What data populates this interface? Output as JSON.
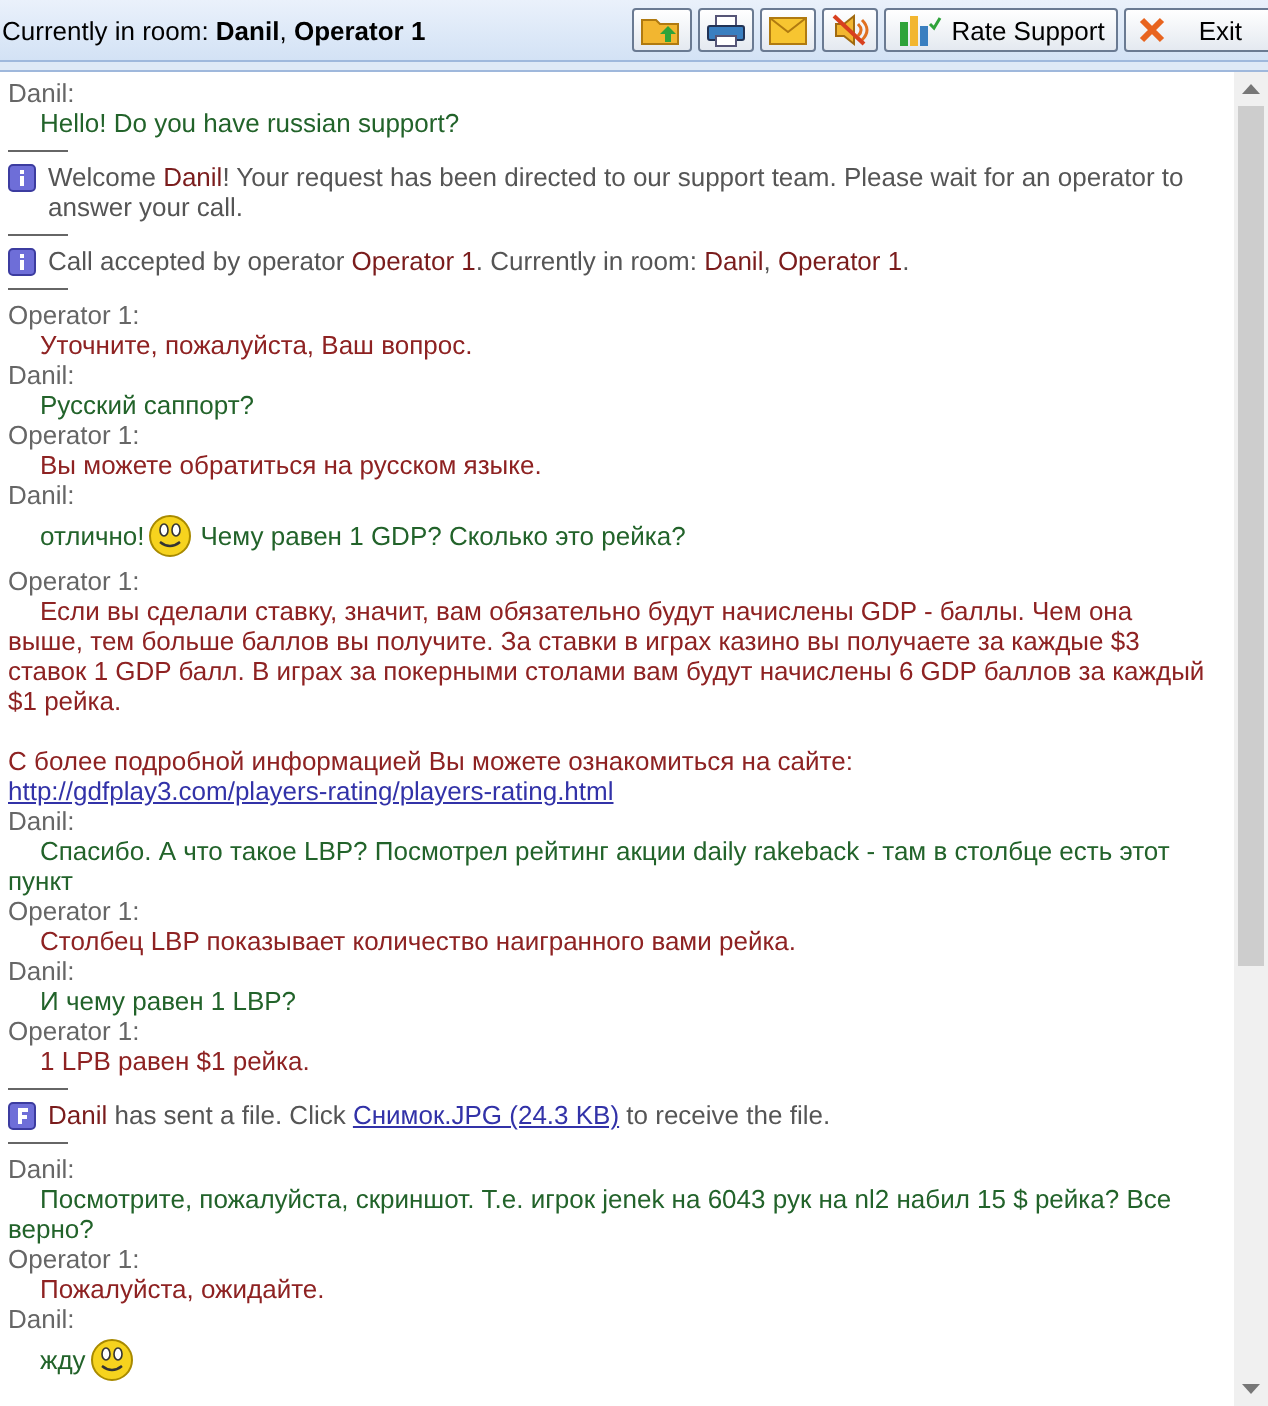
{
  "header": {
    "room": "Currently in room: **Danil**, **Operator 1**"
  },
  "toolbar": [
    {
      "kind": "send-file"
    },
    {
      "kind": "print"
    },
    {
      "kind": "email"
    },
    {
      "kind": "sound"
    },
    {
      "kind": "rate",
      "label": "Rate Support"
    },
    {
      "kind": "exit",
      "label": "Exit"
    }
  ],
  "transcript": [
    {
      "kind": "visitor",
      "sender": "Danil:",
      "body": [
        {
          "kind": "text",
          "text": "Hello! Do you have russian support?"
        }
      ]
    },
    {
      "kind": "info",
      "segments": [
        {
          "kind": "plain",
          "text": "Welcome "
        },
        {
          "kind": "name",
          "text": "Danil"
        },
        {
          "kind": "plain",
          "text": "! Your request has been directed to our support team. Please wait for an operator to answer your call."
        }
      ]
    },
    {
      "kind": "info",
      "segments": [
        {
          "kind": "plain",
          "text": "Call accepted by operator "
        },
        {
          "kind": "name",
          "text": "Operator 1"
        },
        {
          "kind": "plain",
          "text": ". Currently in room: "
        },
        {
          "kind": "name",
          "text": "Danil",
          "after": ", "
        },
        {
          "kind": "name",
          "text": "Operator 1",
          "after": "."
        }
      ]
    },
    {
      "kind": "operator",
      "sender": "Operator 1:",
      "body": [
        {
          "kind": "text",
          "text": "Уточните, пожалуйста, Ваш вопрос."
        }
      ]
    },
    {
      "kind": "visitor",
      "sender": "Danil:",
      "body": [
        {
          "kind": "text",
          "text": "Русский саппорт?"
        }
      ]
    },
    {
      "kind": "operator",
      "sender": "Operator 1:",
      "body": [
        {
          "kind": "text",
          "text": "Вы можете обратиться на русском языке."
        }
      ]
    },
    {
      "kind": "visitor",
      "sender": "Danil:",
      "body": [
        {
          "kind": "text",
          "text": "отлично!"
        },
        {
          "kind": "smiley"
        },
        {
          "kind": "text",
          "text": "Чему равен 1 GDP? Сколько это рейка?"
        }
      ]
    },
    {
      "kind": "operator",
      "sender": "Operator 1:",
      "body": [
        {
          "kind": "text",
          "text": "Если вы сделали ставку, значит, вам обязательно будут начислены GDP - баллы. Чем она выше, тем больше баллов вы получите. За ставки в играх казино вы получаете за каждые $3 ставок 1 GDP балл. В играх за покерными столами вам будут начислены 6 GDP баллов за каждый $1 рейка."
        },
        {
          "kind": "gap"
        },
        {
          "kind": "text",
          "text": "С более подробной информацией Вы можете ознакомиться на сайте:"
        },
        {
          "kind": "break"
        },
        {
          "kind": "link",
          "text": "http://gdfplay3.com/players-rating/players-rating.html"
        }
      ]
    },
    {
      "kind": "visitor",
      "sender": "Danil:",
      "body": [
        {
          "kind": "text",
          "text": "Спасибо. А что такое LBP? Посмотрел рейтинг акции daily rakeback - там в столбце есть этот пункт"
        }
      ]
    },
    {
      "kind": "operator",
      "sender": "Operator 1:",
      "body": [
        {
          "kind": "text",
          "text": "Столбец LBP показывает количество наигранного вами рейка."
        }
      ]
    },
    {
      "kind": "visitor",
      "sender": "Danil:",
      "body": [
        {
          "kind": "text",
          "text": "И чему равен 1 LBP?"
        }
      ]
    },
    {
      "kind": "operator",
      "sender": "Operator 1:",
      "body": [
        {
          "kind": "text",
          "text": "1 LPB равен $1 рейка."
        }
      ]
    },
    {
      "kind": "file",
      "segments": [
        {
          "kind": "name",
          "text": "Danil"
        },
        {
          "kind": "plain",
          "text": " has sent a file. Click "
        },
        {
          "kind": "link",
          "text": "Снимок.JPG (24.3 KB)"
        },
        {
          "kind": "plain",
          "text": " to receive the file."
        }
      ]
    },
    {
      "kind": "visitor",
      "sender": "Danil:",
      "body": [
        {
          "kind": "text",
          "text": "Посмотрите, пожалуйста, скриншот. Т.е. игрок jenek на 6043 рук на nl2 набил 15 $ рейка? Все верно?"
        }
      ]
    },
    {
      "kind": "operator",
      "sender": "Operator 1:",
      "body": [
        {
          "kind": "text",
          "text": "Пожалуйста, ожидайте."
        }
      ]
    },
    {
      "kind": "visitor",
      "sender": "Danil:",
      "body": [
        {
          "kind": "text",
          "text": "жду"
        },
        {
          "kind": "smiley"
        }
      ]
    }
  ]
}
